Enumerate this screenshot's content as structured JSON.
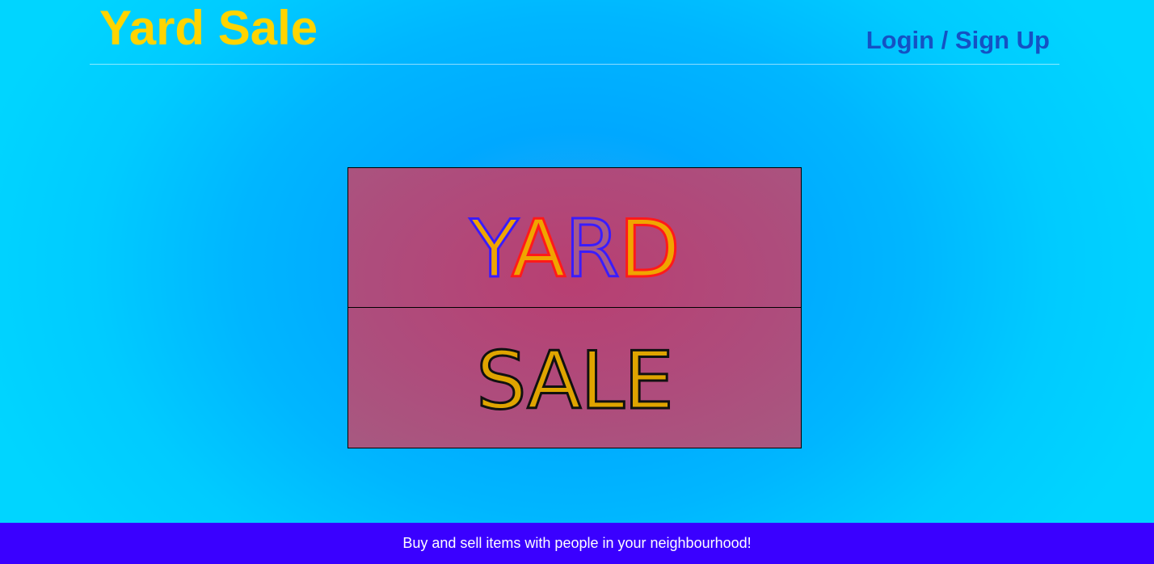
{
  "header": {
    "brand": "Yard Sale",
    "login_label": "Login / Sign Up"
  },
  "sign": {
    "top_word_letters": [
      "Y",
      "A",
      "R",
      "D"
    ],
    "bottom_word": "SALE"
  },
  "footer": {
    "tagline": "Buy and sell items with people in your neighbourhood!"
  },
  "colors": {
    "brand": "#ffd400",
    "login": "#1452c4",
    "sign_background": "#b0457a",
    "letter_fill": "#f0a500",
    "stroke_blue": "#3a1cff",
    "stroke_red": "#ff1a1a",
    "footer_background": "#3a00ff"
  }
}
